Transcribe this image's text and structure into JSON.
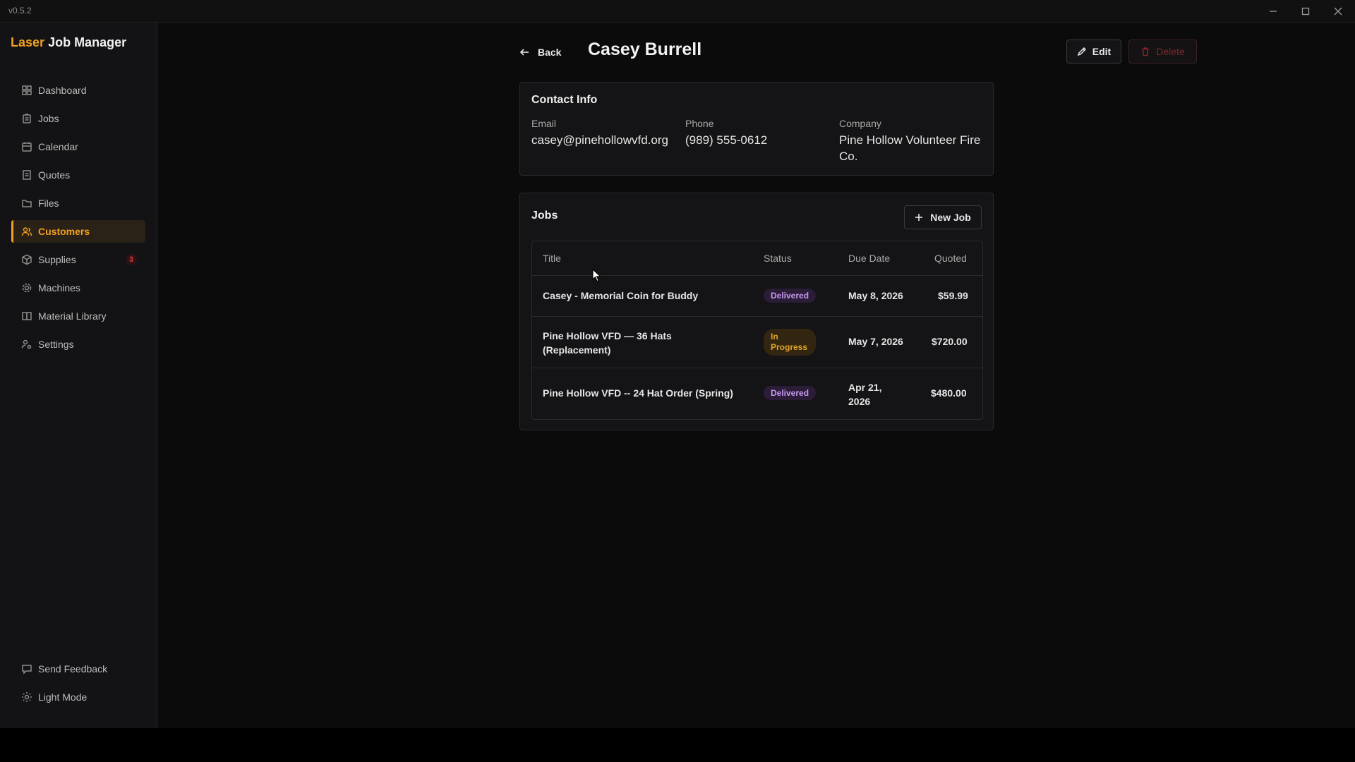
{
  "window": {
    "version": "v0.5.2",
    "controls": {
      "minimize": "minimize-icon",
      "maximize": "maximize-icon",
      "close": "close-icon"
    }
  },
  "brand": {
    "accent": "Laser",
    "rest": "Job Manager"
  },
  "sidebar": {
    "items": [
      {
        "label": "Dashboard",
        "icon": "dashboard-icon"
      },
      {
        "label": "Jobs",
        "icon": "clipboard-icon"
      },
      {
        "label": "Calendar",
        "icon": "calendar-icon"
      },
      {
        "label": "Quotes",
        "icon": "receipt-icon"
      },
      {
        "label": "Files",
        "icon": "folder-icon"
      },
      {
        "label": "Customers",
        "icon": "users-icon",
        "active": true
      },
      {
        "label": "Supplies",
        "icon": "package-icon",
        "badge": "3"
      },
      {
        "label": "Machines",
        "icon": "gear-icon"
      },
      {
        "label": "Material Library",
        "icon": "book-icon"
      },
      {
        "label": "Settings",
        "icon": "user-settings-icon"
      }
    ],
    "bottom": [
      {
        "label": "Send Feedback",
        "icon": "message-icon"
      },
      {
        "label": "Light Mode",
        "icon": "sun-icon"
      }
    ]
  },
  "header": {
    "back_label": "Back",
    "title": "Casey Burrell",
    "edit_label": "Edit",
    "delete_label": "Delete"
  },
  "contact": {
    "title": "Contact Info",
    "email_label": "Email",
    "email": "casey@pinehollowvfd.org",
    "phone_label": "Phone",
    "phone": "(989) 555-0612",
    "company_label": "Company",
    "company_line1": "Pine Hollow Volunteer Fire",
    "company_line2": "Co."
  },
  "jobs": {
    "title": "Jobs",
    "new_job_label": "New Job",
    "columns": [
      "Title",
      "Status",
      "Due Date",
      "Quoted"
    ],
    "rows": [
      {
        "title": "Casey - Memorial Coin for Buddy",
        "status": "Delivered",
        "due": "May 8, 2026",
        "quoted": "$59.99"
      },
      {
        "title_line1": "Pine Hollow VFD — 36 Hats",
        "title_line2": "(Replacement)",
        "status_line1": "In",
        "status_line2": "Progress",
        "due": "May 7, 2026",
        "quoted": "$720.00"
      },
      {
        "title": "Pine Hollow VFD -- 24 Hat Order (Spring)",
        "status": "Delivered",
        "due_line1": "Apr 21,",
        "due_line2": "2026",
        "quoted": "$480.00"
      }
    ]
  },
  "colors": {
    "accent": "#f0a020",
    "delivered": "#c79bf0",
    "in_progress": "#e0a428",
    "danger": "#e03a3a"
  }
}
